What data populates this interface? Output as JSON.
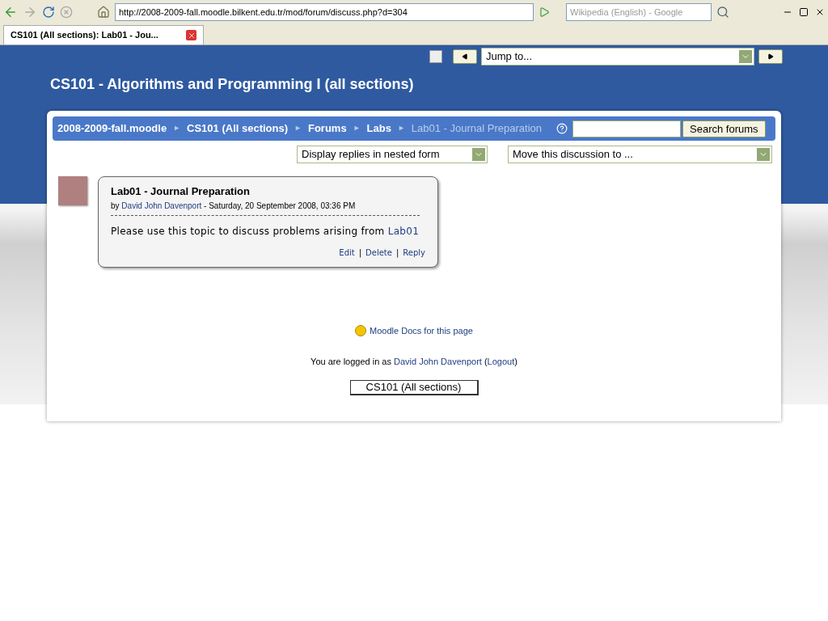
{
  "browser": {
    "url": "http://2008-2009-fall.moodle.bilkent.edu.tr/mod/forum/discuss.php?d=304",
    "search_placeholder": "Wikipedia (English) - Google",
    "tabs": [
      {
        "title": "CS101 (All sections): Lab01 - Jou...",
        "selected": true
      }
    ]
  },
  "header": {
    "jump": "Jump to...",
    "title": "CS101 - Algorithms and Programming I (all sections)"
  },
  "breadcrumb": {
    "items": [
      {
        "label": "2008-2009-fall.moodle",
        "kind": "link"
      },
      {
        "label": "CS101 (All sections)",
        "kind": "link"
      },
      {
        "label": "Forums",
        "kind": "link"
      },
      {
        "label": "Labs",
        "kind": "link"
      },
      {
        "label": "Lab01 - Journal Preparation",
        "kind": "current"
      }
    ],
    "separator": "►",
    "search_button": "Search forums"
  },
  "selects": [
    "Display replies in nested form",
    "Move this discussion to ..."
  ],
  "post": {
    "subject": "Lab01 - Journal Preparation",
    "by": "by ",
    "author": "David John Davenport",
    "date": " - Saturday, 20 September 2008, 03:36 PM",
    "message": "Please use this topic to discuss problems arising from ",
    "message_link": "Lab01",
    "actions": [
      "Edit",
      "Delete",
      "Reply"
    ],
    "action_separator": "|"
  },
  "footer": {
    "docs": "Moodle Docs for this page",
    "login_before": "You are logged in as ",
    "login_user": "David John Davenport",
    "login_between": " (",
    "logout": "Logout",
    "login_after": ")",
    "course_button": "CS101 (All sections)"
  }
}
